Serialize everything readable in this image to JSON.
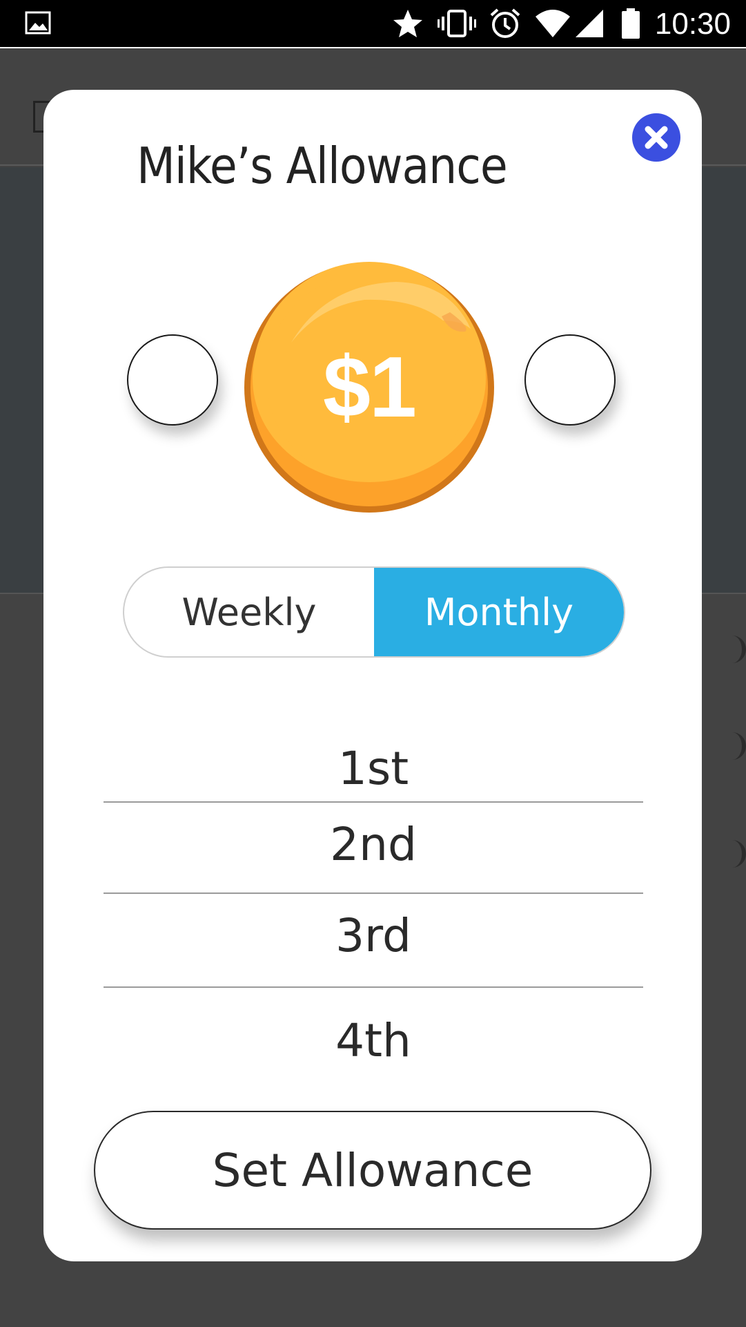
{
  "status_bar": {
    "time": "10:30",
    "icons": [
      "image-icon",
      "star-icon",
      "vibrate-icon",
      "alarm-icon",
      "wifi-icon",
      "signal-icon",
      "battery-icon"
    ]
  },
  "modal": {
    "title": "Mike’s Allowance",
    "amount": "$1",
    "frequency": {
      "options": [
        "Weekly",
        "Monthly"
      ],
      "selected": "Monthly"
    },
    "days": [
      "1st",
      "2nd",
      "3rd",
      "4th"
    ],
    "submit_label": "Set Allowance"
  },
  "colors": {
    "accent": "#2aaee3",
    "close_button": "#3b4fe0",
    "coin_fill": "#ffb83a",
    "coin_rim": "#d67b1a",
    "overlay": "#434343"
  }
}
